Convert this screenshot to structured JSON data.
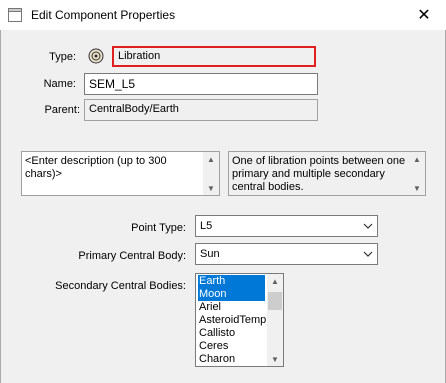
{
  "window": {
    "title": "Edit Component Properties",
    "close_glyph": "✕"
  },
  "form": {
    "type_label": "Type:",
    "type_value": "Libration",
    "name_label": "Name:",
    "name_value": "SEM_L5",
    "parent_label": "Parent:",
    "parent_value": "CentralBody/Earth",
    "description_placeholder": "<Enter description (up to 300 chars)>",
    "info_text": "One of libration points between one primary and multiple secondary central bodies.",
    "point_type_label": "Point Type:",
    "point_type_value": "L5",
    "primary_label": "Primary Central Body:",
    "primary_value": "Sun",
    "secondary_label": "Secondary Central Bodies:",
    "secondary_items": [
      "Earth",
      "Moon",
      "Ariel",
      "AsteroidTempl",
      "Callisto",
      "Ceres",
      "Charon"
    ],
    "secondary_selected": [
      "Earth",
      "Moon"
    ]
  },
  "colors": {
    "selection": "#0078d7",
    "type_field_border": "#e02020"
  },
  "icons": {
    "app": "window-icon",
    "type": "libration-point-icon",
    "close": "close-icon",
    "dropdown": "chevron-down-icon"
  }
}
